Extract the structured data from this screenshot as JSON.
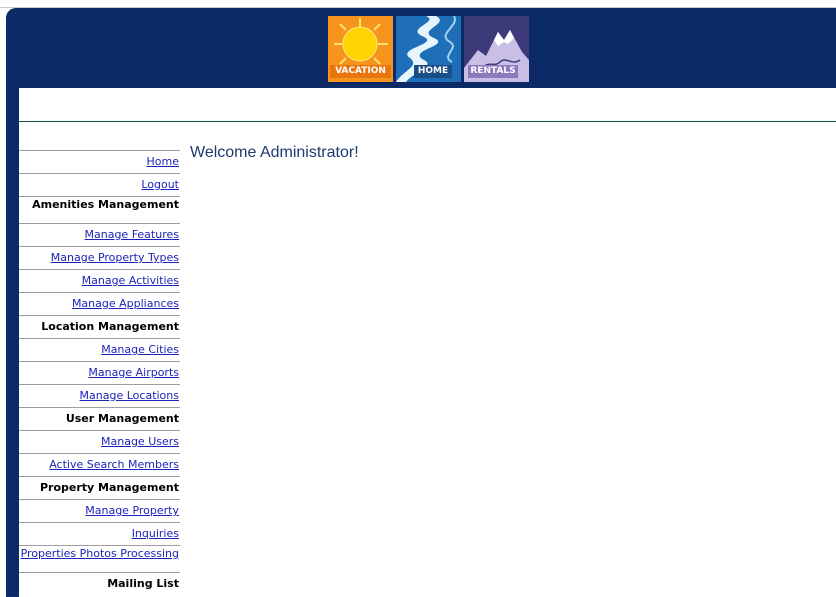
{
  "logo": {
    "tiles": [
      {
        "caption": "VACATION"
      },
      {
        "caption": "HOME"
      },
      {
        "caption": "RENTALS"
      }
    ]
  },
  "colors": {
    "header_blue": "#0b2a66",
    "link": "#1d24b8",
    "welcome_text": "#1e3a6e",
    "rule": "#0e4d44"
  },
  "main": {
    "welcome": "Welcome Administrator!"
  },
  "sidebar": {
    "items": [
      {
        "label": "Home",
        "type": "link"
      },
      {
        "label": "Logout",
        "type": "link"
      },
      {
        "label": "Amenities Management",
        "type": "section"
      },
      {
        "label": "Manage Features",
        "type": "link"
      },
      {
        "label": "Manage Property Types",
        "type": "link"
      },
      {
        "label": "Manage Activities",
        "type": "link"
      },
      {
        "label": "Manage Appliances",
        "type": "link"
      },
      {
        "label": "Location Management",
        "type": "section"
      },
      {
        "label": "Manage Cities",
        "type": "link"
      },
      {
        "label": "Manage Airports",
        "type": "link"
      },
      {
        "label": "Manage Locations",
        "type": "link"
      },
      {
        "label": "User Management",
        "type": "section"
      },
      {
        "label": "Manage Users",
        "type": "link"
      },
      {
        "label": "Active Search Members",
        "type": "link"
      },
      {
        "label": "Property Management",
        "type": "section"
      },
      {
        "label": "Manage Property",
        "type": "link"
      },
      {
        "label": "Inquiries",
        "type": "link"
      },
      {
        "label": "Properties Photos Processing",
        "type": "link"
      },
      {
        "label": "Mailing List",
        "type": "section"
      }
    ]
  }
}
